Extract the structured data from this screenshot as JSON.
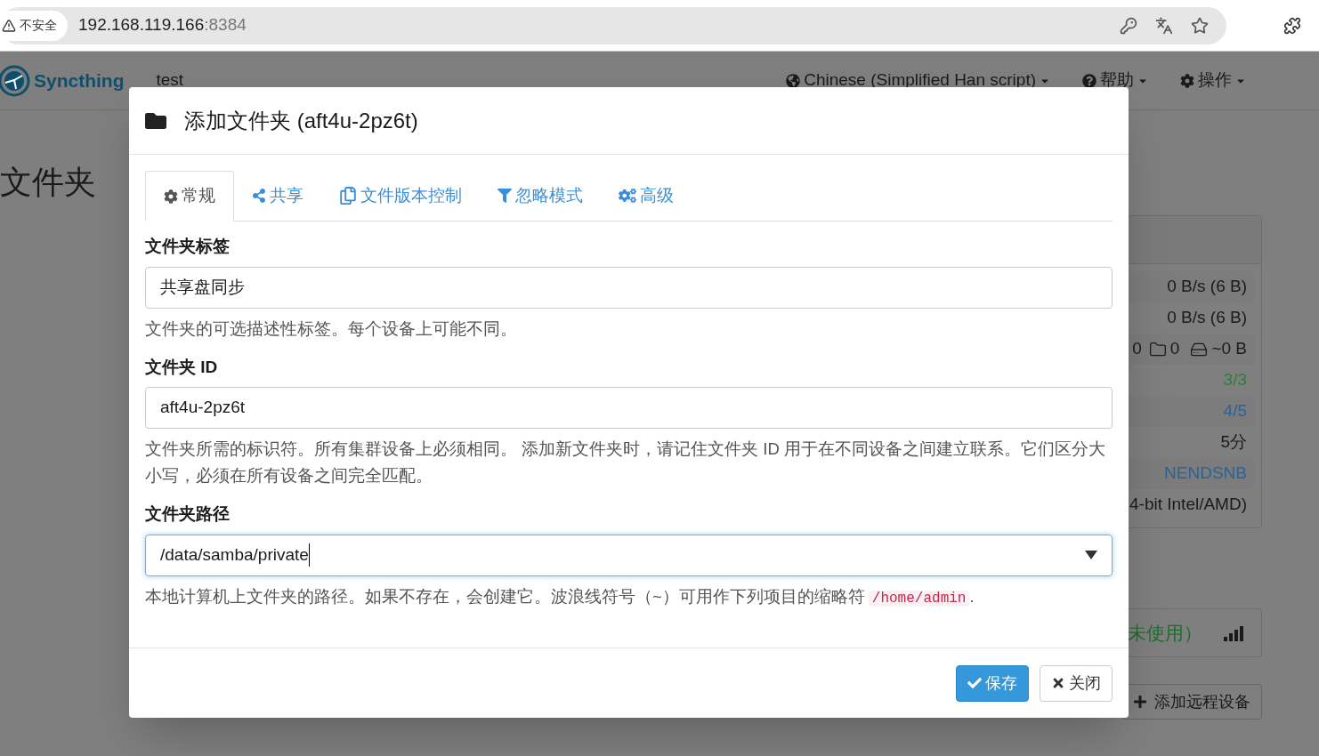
{
  "browser": {
    "security_label": "不安全",
    "url_host": "192.168.119.166",
    "url_port": ":8384"
  },
  "app": {
    "brand": "Syncthing",
    "device_name": "test",
    "menus": [
      {
        "kind": "language",
        "label": "Chinese (Simplified Han script)"
      },
      {
        "kind": "help",
        "label": "帮助"
      },
      {
        "kind": "actions",
        "label": "操作"
      }
    ]
  },
  "page_title": "文件夹",
  "status_rows": [
    {
      "kind": "text",
      "text": "0 B/s (6 B)",
      "color": "#1a1a1a"
    },
    {
      "kind": "text",
      "text": "0 B/s (6 B)",
      "color": "#1a1a1a"
    },
    {
      "kind": "counts",
      "values": [
        "0",
        "0",
        "~0 B"
      ]
    },
    {
      "kind": "text",
      "text": "3/3",
      "color": "#2e7d3a"
    },
    {
      "kind": "text",
      "text": "4/5",
      "color": "#2a6496"
    },
    {
      "kind": "text",
      "text": "5分",
      "color": "#1a1a1a"
    },
    {
      "kind": "text",
      "text": "NENDSNB",
      "color": "#2a6496"
    },
    {
      "kind": "text",
      "text": "4-bit Intel/AMD)",
      "color": "#1a1a1a"
    }
  ],
  "device_panel": {
    "status": "未使用）"
  },
  "add_device_button": "添加远程设备",
  "modal": {
    "title": "添加文件夹 (aft4u-2pz6t)",
    "tabs": [
      {
        "kind": "general",
        "label": "常规",
        "selected": true
      },
      {
        "kind": "sharing",
        "label": "共享",
        "selected": false
      },
      {
        "kind": "versioning",
        "label": "文件版本控制",
        "selected": false
      },
      {
        "kind": "ignore",
        "label": "忽略模式",
        "selected": false
      },
      {
        "kind": "advanced",
        "label": "高级",
        "selected": false
      }
    ],
    "fields": [
      {
        "kind": "text",
        "label": "文件夹标签",
        "value": "共享盘同步",
        "focused": false,
        "help": "文件夹的可选描述性标签。每个设备上可能不同。"
      },
      {
        "kind": "text",
        "label": "文件夹 ID",
        "value": "aft4u-2pz6t",
        "focused": false,
        "help": "文件夹所需的标识符。所有集群设备上必须相同。 添加新文件夹时，请记住文件夹 ID 用于在不同设备之间建立联系。它们区分大小写，必须在所有设备之间完全匹配。"
      },
      {
        "kind": "path",
        "label": "文件夹路径",
        "value": "/data/samba/private",
        "focused": true,
        "help": "本地计算机上文件夹的路径。如果不存在，会创建它。波浪线符号（~）可用作下列项目的缩略符",
        "help_code": "/home/admin",
        "help_suffix": "."
      }
    ],
    "buttons": [
      {
        "kind": "primary",
        "label": "保存"
      },
      {
        "kind": "default",
        "label": "关闭"
      }
    ]
  }
}
